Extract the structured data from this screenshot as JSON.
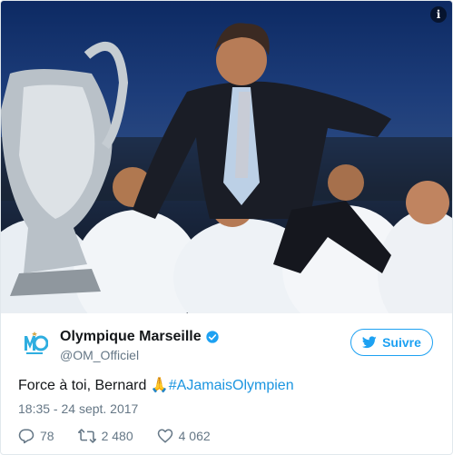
{
  "media": {
    "info_glyph": "i"
  },
  "account": {
    "name": "Olympique Marseille",
    "handle": "@OM_Officiel",
    "verified": true,
    "avatar_icon": "om-crest-icon"
  },
  "follow_button": {
    "label": "Suivre",
    "icon": "twitter-bird-icon"
  },
  "tweet": {
    "text": "Force à toi, Bernard ",
    "emoji": "🙏",
    "hashtag": "#AJamaisOlympien",
    "timestamp": "18:35 - 24 sept. 2017"
  },
  "actions": {
    "replies": "78",
    "retweets": "2 480",
    "likes": "4 062"
  },
  "colors": {
    "accent": "#1da1f2",
    "om_blue": "#2faee0",
    "muted": "#657786"
  }
}
